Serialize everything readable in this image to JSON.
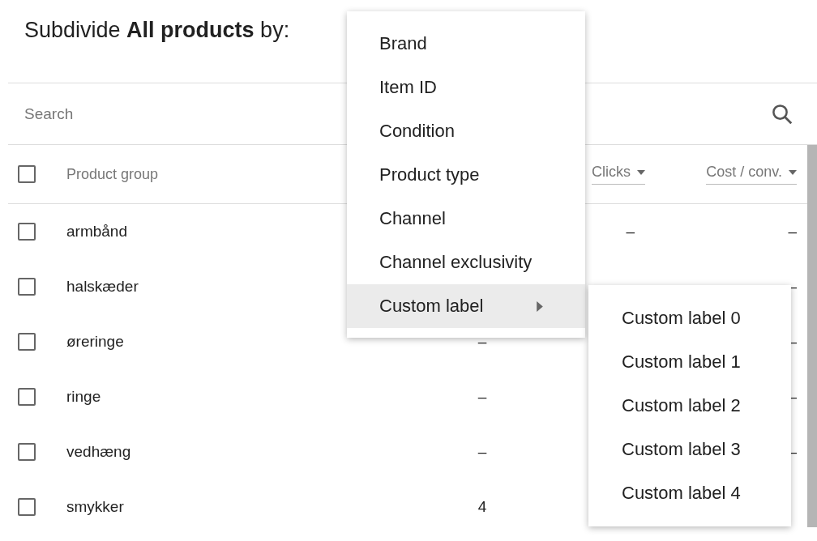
{
  "heading": "Subdivide **All products** by:",
  "search": {
    "placeholder": "Search"
  },
  "table": {
    "select_all": {
      "checked": false
    },
    "columns": [
      {
        "label": "Product group",
        "sortable": false
      },
      {
        "label": "Clicks",
        "sortable": true
      },
      {
        "label": "Cost / conv.",
        "sortable": true
      }
    ],
    "rows": [
      {
        "label": "armbånd",
        "checked": false,
        "clicks": "–",
        "cost_conv": "–"
      },
      {
        "label": "halskæder",
        "checked": false,
        "cost_conv": "–"
      },
      {
        "label": "øreringe",
        "checked": false,
        "column_3": "–",
        "cost_conv": "–"
      },
      {
        "label": "ringe",
        "checked": false,
        "column_3": "–",
        "cost_conv": "–"
      },
      {
        "label": "vedhæng",
        "checked": false,
        "column_3": "–",
        "cost_conv": "–"
      },
      {
        "label": "smykker",
        "checked": false,
        "column_3": "4"
      }
    ]
  },
  "menu": {
    "items": [
      {
        "label": "Brand",
        "selected": false,
        "has_submenu": false
      },
      {
        "label": "Item ID",
        "selected": false,
        "has_submenu": false
      },
      {
        "label": "Condition",
        "selected": false,
        "has_submenu": false
      },
      {
        "label": "Product type",
        "selected": false,
        "has_submenu": false
      },
      {
        "label": "Channel",
        "selected": false,
        "has_submenu": false
      },
      {
        "label": "Channel exclusivity",
        "selected": false,
        "has_submenu": false
      },
      {
        "label": "Custom label",
        "selected": true,
        "has_submenu": true
      }
    ]
  },
  "submenu": {
    "items": [
      {
        "label": "Custom label 0",
        "selected": false
      },
      {
        "label": "Custom label 1",
        "selected": false
      },
      {
        "label": "Custom label 2",
        "selected": false
      },
      {
        "label": "Custom label 3",
        "selected": false
      },
      {
        "label": "Custom label 4",
        "selected": false
      }
    ]
  }
}
